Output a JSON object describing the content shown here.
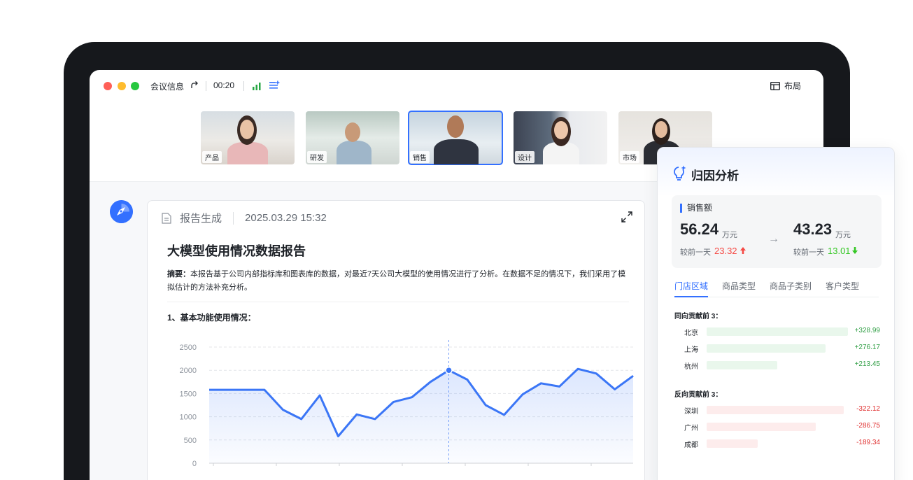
{
  "titlebar": {
    "meeting_info": "会议信息",
    "timer": "00:20",
    "layout_label": "布局"
  },
  "participants": [
    {
      "label": "产品",
      "active": false
    },
    {
      "label": "研发",
      "active": false
    },
    {
      "label": "销售",
      "active": true
    },
    {
      "label": "设计",
      "active": false
    },
    {
      "label": "市场",
      "active": false
    }
  ],
  "report": {
    "header_label": "报告生成",
    "timestamp": "2025.03.29 15:32",
    "title": "大模型使用情况数据报告",
    "summary_prefix": "摘要：",
    "summary_text": "本报告基于公司内部指标库和图表库的数据，对最近7天公司大模型的使用情况进行了分析。在数据不足的情况下，我们采用了模拟估计的方法补充分析。",
    "section_title": "1、基本功能使用情况："
  },
  "chart_data": {
    "type": "area",
    "ylim": [
      0,
      2500
    ],
    "yticks": [
      "0",
      "500",
      "1000",
      "1500",
      "2000",
      "2500"
    ],
    "series": [
      {
        "values": [
          1580,
          1580,
          1580,
          1580,
          1150,
          950,
          1460,
          580,
          1050,
          950,
          1320,
          1420,
          1750,
          2000,
          1800,
          1250,
          1040,
          1480,
          1720,
          1650,
          2030,
          1930,
          1590,
          1880
        ],
        "highlight_index": 13
      }
    ],
    "grid": true,
    "accent_color": "#3b76f6"
  },
  "panel": {
    "title": "归因分析",
    "metric_name": "销售额",
    "before_value": "56.24",
    "before_unit": "万元",
    "before_compare_label": "较前一天",
    "before_delta": "23.32",
    "after_value": "43.23",
    "after_unit": "万元",
    "after_compare_label": "较前一天",
    "after_delta": "13.01",
    "tabs": [
      "门店区域",
      "商品类型",
      "商品子类别",
      "客户类型"
    ],
    "positive_title": "同向贡献前 3：",
    "positive_rows": [
      {
        "label": "北京",
        "value": "+328.99",
        "ratio": 1.0
      },
      {
        "label": "上海",
        "value": "+276.17",
        "ratio": 0.84
      },
      {
        "label": "杭州",
        "value": "+213.45",
        "ratio": 0.5
      }
    ],
    "negative_title": "反向贡献前 3：",
    "negative_rows": [
      {
        "label": "深圳",
        "value": "-322.12",
        "ratio": 0.97
      },
      {
        "label": "广州",
        "value": "-286.75",
        "ratio": 0.77
      },
      {
        "label": "成都",
        "value": "-189.34",
        "ratio": 0.36
      }
    ]
  }
}
